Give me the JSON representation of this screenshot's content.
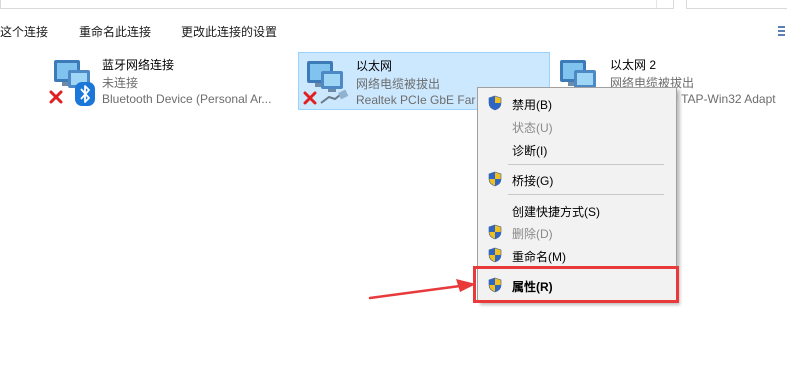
{
  "toolbar": {
    "cmd1": "这个连接",
    "cmd2": "重命名此连接",
    "cmd3": "更改此连接的设置"
  },
  "adapters": [
    {
      "name": "蓝牙网络连接",
      "status": "未连接",
      "device": "Bluetooth Device (Personal Ar..."
    },
    {
      "name": "以太网",
      "status": "网络电缆被拔出",
      "device": "Realtek PCIe GbE Far"
    },
    {
      "name": "以太网 2",
      "status": "网络电缆被拔出",
      "device": "J TAP-Win32 Adapt"
    }
  ],
  "menu": {
    "items": [
      {
        "label": "禁用(B)",
        "enabled": true,
        "shield": true
      },
      {
        "label": "状态(U)",
        "enabled": false,
        "shield": false
      },
      {
        "label": "诊断(I)",
        "enabled": true,
        "shield": false
      },
      {
        "label": "桥接(G)",
        "enabled": true,
        "shield": true
      },
      {
        "label": "创建快捷方式(S)",
        "enabled": true,
        "shield": false
      },
      {
        "label": "删除(D)",
        "enabled": false,
        "shield": true
      },
      {
        "label": "重命名(M)",
        "enabled": true,
        "shield": true
      },
      {
        "label": "属性(R)",
        "enabled": true,
        "shield": true,
        "default": true
      }
    ]
  },
  "colors": {
    "selection_bg": "#cce8ff",
    "selection_border": "#99d1ff",
    "annotation_red": "#e8393b",
    "menu_bg": "#f2f2f2"
  }
}
